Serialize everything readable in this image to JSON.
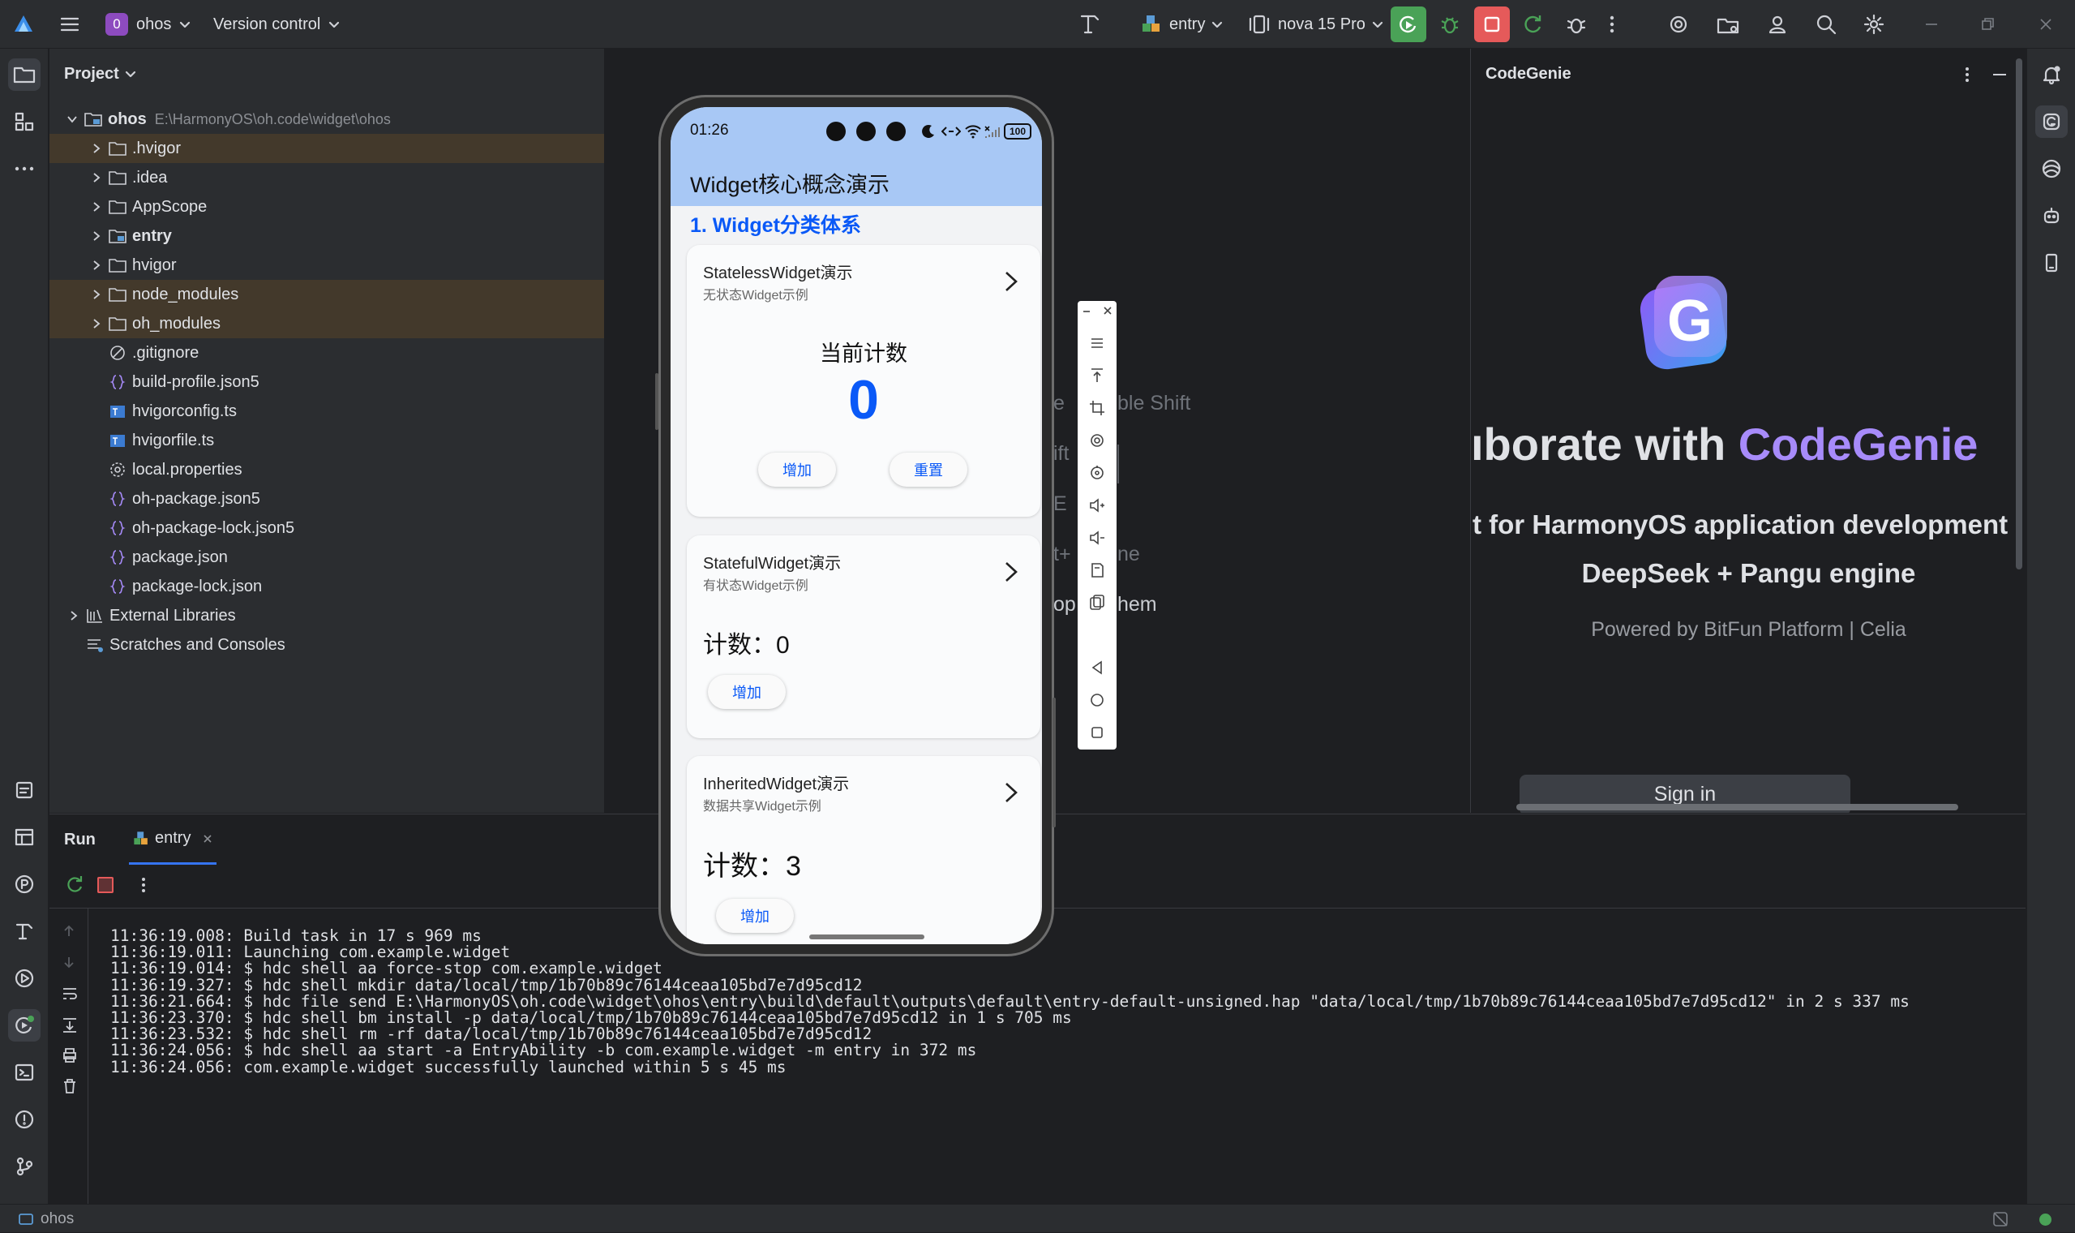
{
  "titlebar": {
    "project_badge": "0",
    "project_name": "ohos",
    "vcs": "Version control",
    "run_config": "entry",
    "device": "nova 15 Pro"
  },
  "project_panel": {
    "title": "Project",
    "root": {
      "name": "ohos",
      "path": "E:\\HarmonyOS\\oh.code\\widget\\ohos"
    },
    "items": [
      {
        "label": ".hvigor"
      },
      {
        "label": ".idea"
      },
      {
        "label": "AppScope"
      },
      {
        "label": "entry"
      },
      {
        "label": "hvigor"
      },
      {
        "label": "node_modules"
      },
      {
        "label": "oh_modules"
      },
      {
        "label": ".gitignore"
      },
      {
        "label": "build-profile.json5"
      },
      {
        "label": "hvigorconfig.ts"
      },
      {
        "label": "hvigorfile.ts"
      },
      {
        "label": "local.properties"
      },
      {
        "label": "oh-package.json5"
      },
      {
        "label": "oh-package-lock.json5"
      },
      {
        "label": "package.json"
      },
      {
        "label": "package-lock.json"
      }
    ],
    "external": "External Libraries",
    "scratches": "Scratches and Consoles"
  },
  "editor_hints": {
    "h1": "e",
    "h1b": "ble Shift",
    "h2": "ift",
    "h3": "E",
    "h4": "t+",
    "h4b": "ne",
    "h5": "op",
    "h5b": "hem"
  },
  "phone": {
    "time": "01:26",
    "battery": "100",
    "app_title": "Widget核心概念演示",
    "section_title": "1. Widget分类体系",
    "cards": [
      {
        "title": "StatelessWidget演示",
        "subtitle": "无状态Widget示例",
        "counter_label": "当前计数",
        "counter_value": "0",
        "btn_add": "增加",
        "btn_reset": "重置"
      },
      {
        "title": "StatefulWidget演示",
        "subtitle": "有状态Widget示例",
        "count_text": "计数：0",
        "btn_add": "增加"
      },
      {
        "title": "InheritedWidget演示",
        "subtitle": "数据共享Widget示例",
        "count_text": "计数：3",
        "btn_add": "增加"
      }
    ]
  },
  "codegenie": {
    "title": "CodeGenie",
    "headline_prefix": "ıborate with ",
    "headline_brand": "CodeGenie",
    "subtitle": "t for HarmonyOS application development",
    "engine": "DeepSeek + Pangu engine",
    "powered": "Powered by BitFun Platform | Celia",
    "signin": "Sign in",
    "brand_color": "#a78bfa"
  },
  "run_panel": {
    "tab_run": "Run",
    "tab_entry": "entry",
    "logs": [
      "11:36:19.008: Build task in 17 s 969 ms",
      "11:36:19.011: Launching com.example.widget",
      "11:36:19.014: $ hdc shell aa force-stop com.example.widget",
      "11:36:19.327: $ hdc shell mkdir data/local/tmp/1b70b89c76144ceaa105bd7e7d95cd12",
      "11:36:21.664: $ hdc file send E:\\HarmonyOS\\oh.code\\widget\\ohos\\entry\\build\\default\\outputs\\default\\entry-default-unsigned.hap \"data/local/tmp/1b70b89c76144ceaa105bd7e7d95cd12\" in 2 s 337 ms",
      "11:36:23.370: $ hdc shell bm install -p data/local/tmp/1b70b89c76144ceaa105bd7e7d95cd12 in 1 s 705 ms",
      "11:36:23.532: $ hdc shell rm -rf data/local/tmp/1b70b89c76144ceaa105bd7e7d95cd12",
      "11:36:24.056: $ hdc shell aa start -a EntryAbility -b com.example.widget -m entry in 372 ms",
      "11:36:24.056: com.example.widget successfully launched within 5 s 45 ms"
    ]
  },
  "statusbar": {
    "project": "ohos"
  },
  "colors": {
    "accent": "#0a59f7",
    "phone_header": "#a8c8f5",
    "highlight_row": "#43392b",
    "run_green": "#4aa257",
    "stop_red": "#e55a5a"
  }
}
